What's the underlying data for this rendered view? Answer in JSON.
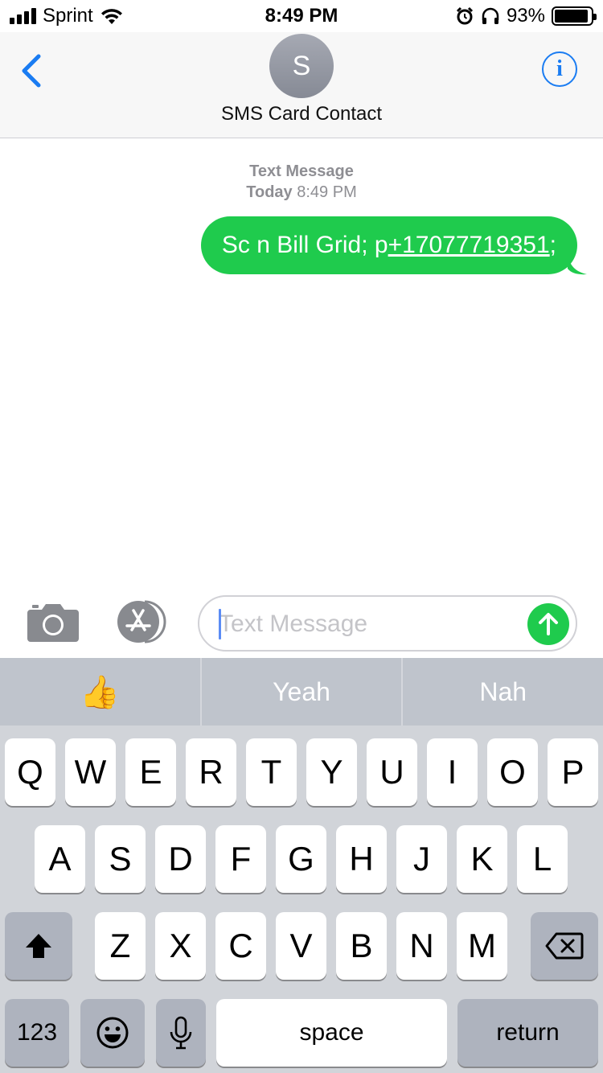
{
  "status_bar": {
    "carrier": "Sprint",
    "time": "8:49 PM",
    "battery_percent": "93%",
    "battery_level": 0.93,
    "icons": [
      "signal-icon",
      "wifi-icon",
      "alarm-icon",
      "headphones-icon",
      "battery-icon"
    ]
  },
  "header": {
    "back_icon": "chevron-left-icon",
    "avatar_initial": "S",
    "contact_name": "SMS Card Contact",
    "info_icon": "info-icon",
    "info_glyph": "i"
  },
  "conversation": {
    "service_label": "Text Message",
    "day_label": "Today",
    "time_label": "8:49 PM",
    "messages": [
      {
        "direction": "outgoing",
        "text_before": "Sc n Bill Grid; p ",
        "link": "+17077719351",
        "text_after": ";"
      }
    ]
  },
  "input_bar": {
    "camera_icon": "camera-icon",
    "appstore_icon": "app-store-icon",
    "placeholder": "Text Message",
    "value": "",
    "send_icon": "arrow-up-icon"
  },
  "keyboard": {
    "suggestions": [
      "👍",
      "Yeah",
      "Nah"
    ],
    "rows": [
      [
        "Q",
        "W",
        "E",
        "R",
        "T",
        "Y",
        "U",
        "I",
        "O",
        "P"
      ],
      [
        "A",
        "S",
        "D",
        "F",
        "G",
        "H",
        "J",
        "K",
        "L"
      ],
      [
        "Z",
        "X",
        "C",
        "V",
        "B",
        "N",
        "M"
      ]
    ],
    "shift_icon": "shift-icon",
    "delete_icon": "delete-icon",
    "numbers_label": "123",
    "emoji_icon": "emoji-icon",
    "mic_icon": "microphone-icon",
    "space_label": "space",
    "return_label": "return"
  },
  "colors": {
    "accent_blue": "#1a7cf2",
    "bubble_green": "#1fcb4d",
    "meta_gray": "#8e8e93",
    "keyboard_bg": "#d1d4d9"
  }
}
